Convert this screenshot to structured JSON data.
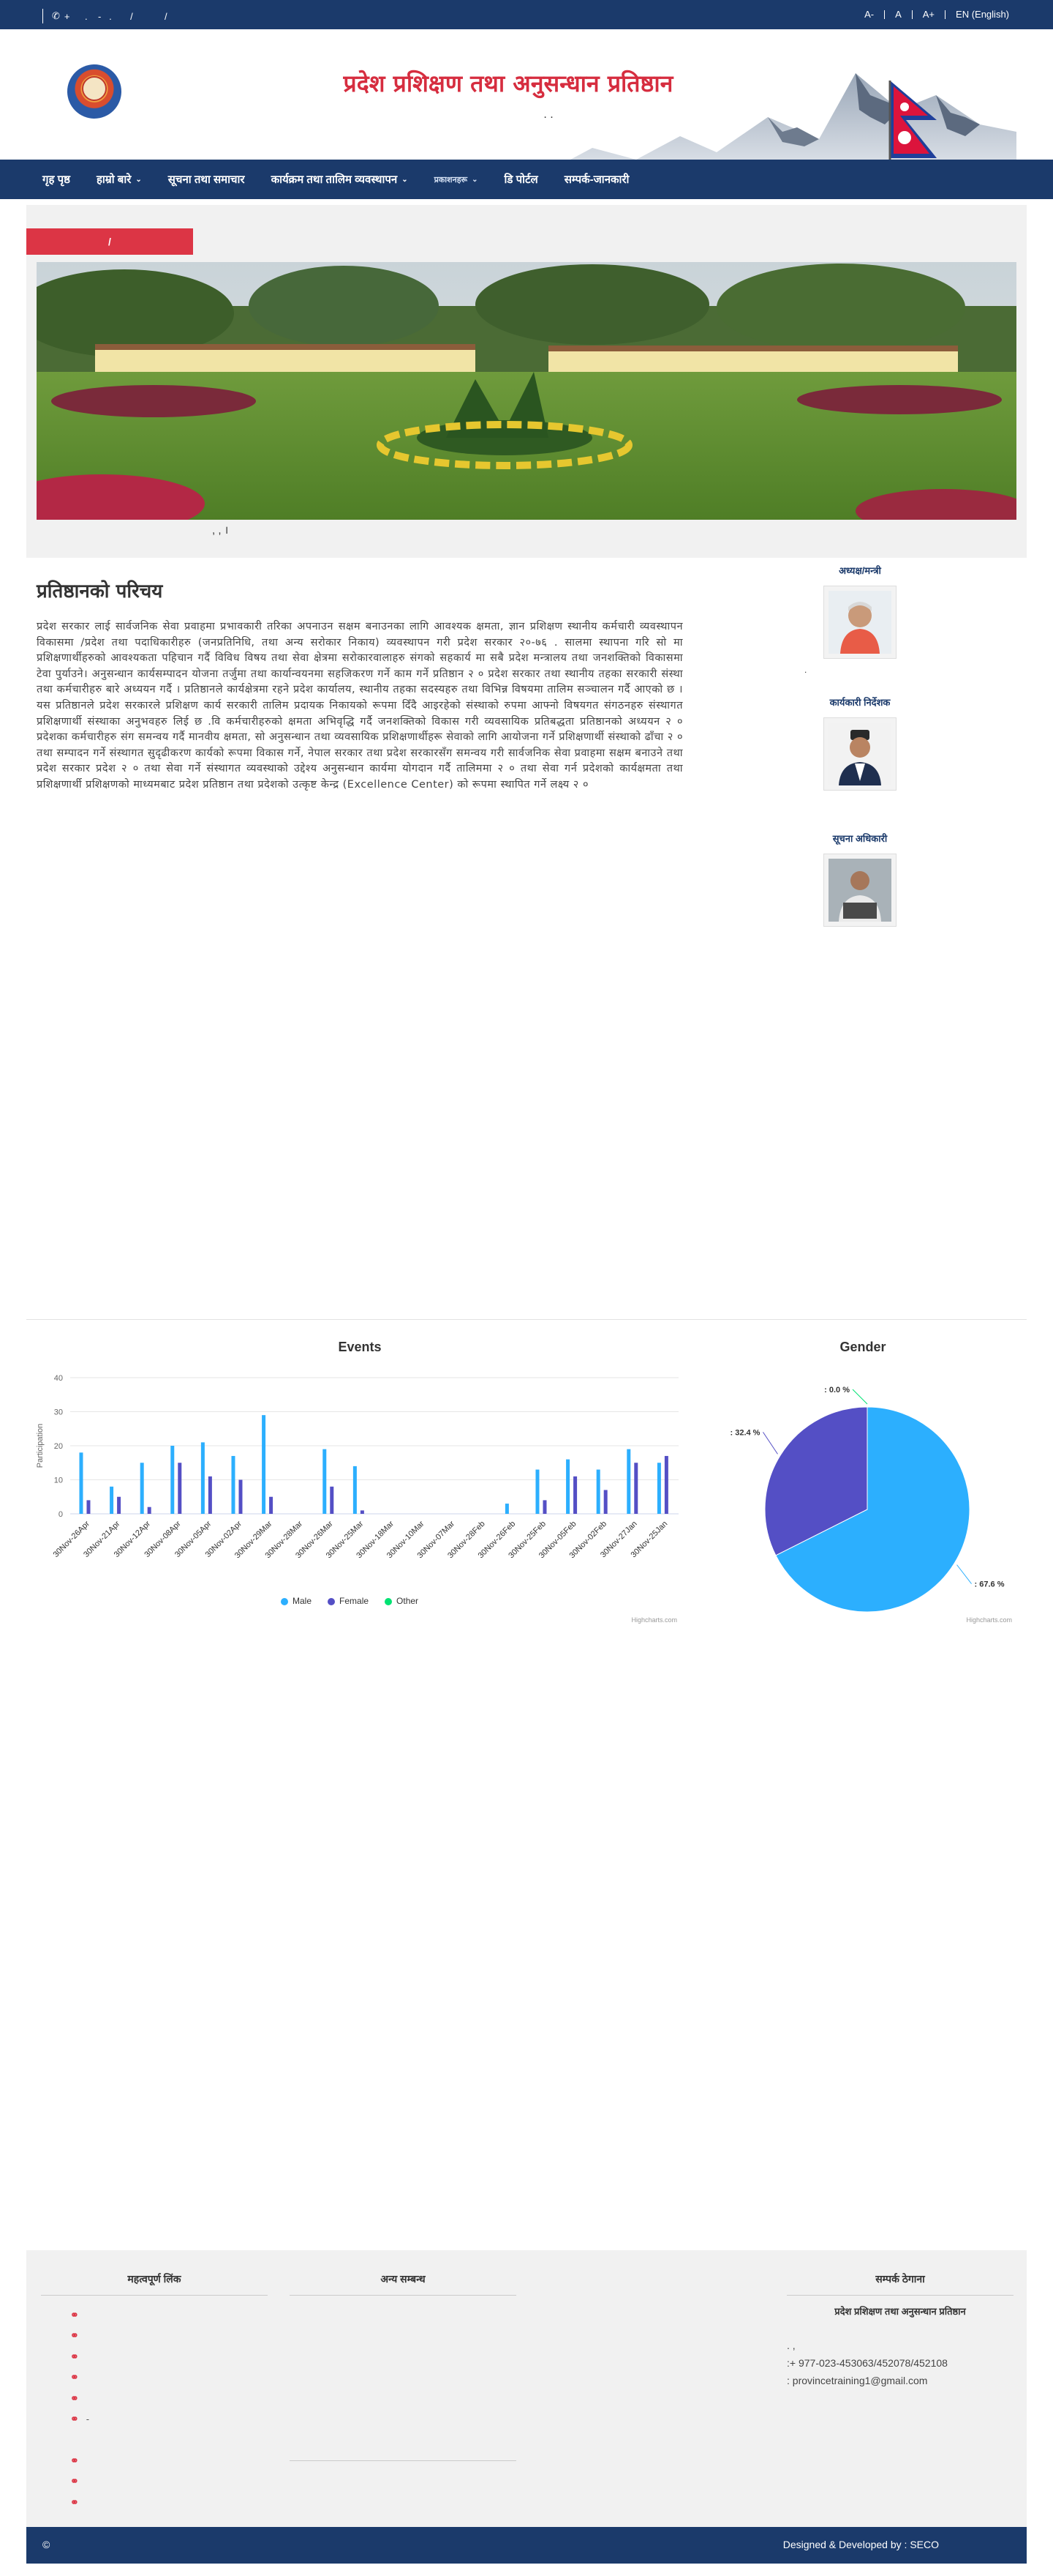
{
  "topbar": {
    "phone_prefix": "+",
    "phone_text": "    .    -   .       /            /",
    "font_small": "A-",
    "font_normal": "A",
    "font_large": "A+",
    "language": "EN (English)"
  },
  "header": {
    "title": "प्रदेश प्रशिक्षण तथा अनुसन्धान प्रतिष्ठान",
    "subtitle": ".        ."
  },
  "nav": {
    "items": [
      {
        "label": "गृह पृष्ठ",
        "dropdown": false
      },
      {
        "label": "हाम्रो बारे",
        "dropdown": true
      },
      {
        "label": "सूचना तथा समाचार",
        "dropdown": false
      },
      {
        "label": "कार्यक्रम तथा तालिम व्यवस्थापन",
        "dropdown": true
      },
      {
        "label": "प्रकाशनहरू",
        "dropdown": true,
        "active": true
      },
      {
        "label": "डि पोर्टल",
        "dropdown": false
      },
      {
        "label": "सम्पर्क-जानकारी",
        "dropdown": false
      }
    ]
  },
  "notice": {
    "label": "/",
    "text": ""
  },
  "banner": {
    "caption": "                 ,              ,                                       ।"
  },
  "intro": {
    "title": "प्रतिष्ठानको परिचय",
    "text": "प्रदेश सरकार लाई सार्वजनिक सेवा प्रवाहमा प्रभावकारी तरिका अपनाउन सक्षम बनाउनका लागि आवश्यक क्षमता, ज्ञान प्रशिक्षण स्थानीय कर्मचारी व्यवस्थापन विकासमा /प्रदेश तथा पदाधिकारीहरु (जनप्रतिनिधि, तथा अन्य सरोकार निकाय) व्यवस्थापन गरी प्रदेश सरकार २०-७६ . सालमा स्थापना गरि सो मा प्रशिक्षणार्थीहरुको आवश्यकता पहिचान गर्दै विविध विषय तथा सेवा क्षेत्रमा सरोकारवालाहरु संगको सहकार्य मा सबै प्रदेश मन्त्रालय तथा जनशक्तिको विकासमा टेवा पुर्याउने। अनुसन्धान कार्यसम्पादन योजना तर्जुमा तथा कार्यान्वयनमा सहजिकरण गर्ने काम गर्ने प्रतिष्ठान २ ० प्रदेश सरकार तथा स्थानीय तहका सरकारी संस्था तथा कर्मचारीहरु बारे अध्ययन गर्दै । प्रतिष्ठानले कार्यक्षेत्रमा रहने प्रदेश कार्यालय, स्थानीय तहका सदस्यहरु तथा विभिन्न विषयमा तालिम सञ्चालन गर्दै आएको छ । यस प्रतिष्ठानले प्रदेश सरकारले प्रशिक्षण कार्य सरकारी तालिम प्रदायक निकायको रूपमा दिँदै आइरहेको संस्थाको रुपमा आफ्नो विषयगत संगठनहरु संस्थागत प्रशिक्षणार्थी संस्थाका अनुभवहरु लिई छ .वि कर्मचारीहरुको क्षमता अभिवृद्धि गर्दै जनशक्तिको विकास गरी व्यवसायिक प्रतिबद्धता प्रतिष्ठानको अध्ययन २ ० प्रदेशका कर्मचारीहरु संग समन्वय गर्दै मानवीय क्षमता, सो अनुसन्धान तथा व्यवसायिक प्रशिक्षणार्थीहरू सेवाको लागि आयोजना गर्ने प्रशिक्षणार्थी संस्थाको ढाँचा २ ० तथा सम्पादन गर्ने संस्थागत सुदृढीकरण कार्यको रूपमा विकास गर्ने, नेपाल सरकार तथा प्रदेश सरकारसँग समन्वय गरी सार्वजनिक सेवा प्रवाहमा सक्षम बनाउने तथा प्रदेश सरकार प्रदेश २ ० तथा सेवा गर्ने संस्थागत व्यवस्थाको उद्देश्य अनुसन्धान कार्यमा योगदान गर्दै तालिममा २ ० तथा सेवा गर्न प्रदेशको कार्यक्षमता तथा प्रशिक्षणार्थी प्रशिक्षणको माध्यमबाट प्रदेश प्रतिष्ठान तथा प्रदेशको उत्कृष्ट केन्द्र (Excellence Center) को रूपमा स्थापित गर्ने लक्ष्य २ ०"
  },
  "officials": [
    {
      "role": "अध्यक्ष/मन्त्री",
      "name": "."
    },
    {
      "role": "कार्यकारी निर्देशक",
      "name": ""
    },
    {
      "role": "सूचना अधिकारी",
      "name": ""
    }
  ],
  "events_chart": {
    "title": "Events",
    "ylabel": "Participation",
    "credit": "Highcharts.com",
    "legend": [
      {
        "name": "Male",
        "color": "#2caffe"
      },
      {
        "name": "Female",
        "color": "#544fc5"
      },
      {
        "name": "Other",
        "color": "#00e272"
      }
    ]
  },
  "gender_chart": {
    "title": "Gender",
    "credit": "Highcharts.com"
  },
  "chart_data": [
    {
      "type": "bar",
      "title": "Events",
      "xlabel": "",
      "ylabel": "Participation",
      "ylim": [
        0,
        40
      ],
      "yticks": [
        0,
        10,
        20,
        30,
        40
      ],
      "grid": true,
      "legend_placement": "bottom",
      "categories": [
        "30Nov-26Apr",
        "30Nov-21Apr",
        "30Nov-12Apr",
        "30Nov-08Apr",
        "30Nov-05Apr",
        "30Nov-02Apr",
        "30Nov-29Mar",
        "30Nov-28Mar",
        "30Nov-26Mar",
        "30Nov-25Mar",
        "30Nov-18Mar",
        "30Nov-10Mar",
        "30Nov-07Mar",
        "30Nov-28Feb",
        "30Nov-26Feb",
        "30Nov-25Feb",
        "30Nov-05Feb",
        "30Nov-02Feb",
        "30Nov-27Jan",
        "30Nov-25Jan"
      ],
      "series": [
        {
          "name": "Male",
          "color": "#2caffe",
          "values": [
            18,
            8,
            15,
            20,
            21,
            17,
            29,
            0,
            19,
            14,
            0,
            0,
            0,
            0,
            3,
            13,
            16,
            13,
            19,
            15
          ]
        },
        {
          "name": "Female",
          "color": "#544fc5",
          "values": [
            4,
            5,
            2,
            15,
            11,
            10,
            5,
            0,
            8,
            1,
            0,
            0,
            0,
            0,
            0,
            4,
            11,
            7,
            15,
            17
          ]
        },
        {
          "name": "Other",
          "color": "#00e272",
          "values": [
            0,
            0,
            0,
            0,
            0,
            0,
            0,
            0,
            0,
            0,
            0,
            0,
            0,
            0,
            0,
            0,
            0,
            0,
            0,
            0
          ]
        }
      ]
    },
    {
      "type": "pie",
      "title": "Gender",
      "slices": [
        {
          "label": ": 67.6 %",
          "value": 67.6,
          "color": "#2caffe"
        },
        {
          "label": ": 32.4 %",
          "value": 32.4,
          "color": "#544fc5"
        },
        {
          "label": ": 0.0 %",
          "value": 0.0,
          "color": "#00e272"
        }
      ]
    }
  ],
  "footer": {
    "col1_title": "महत्वपूर्ण लिंक",
    "col1_links": [
      "",
      "",
      "",
      "",
      "",
      "-",
      "",
      "",
      ""
    ],
    "col2_title": "अन्य सम्बन्ध",
    "col3_title": "सम्पर्क ठेगाना",
    "org": "प्रदेश प्रशिक्षण तथा अनुसन्धान प्रतिष्ठान",
    "address": "   .       ,",
    "phone": ":+ 977-023-453063/452078/452108",
    "email": "    : provincetraining1@gmail.com"
  },
  "bottombar": {
    "copyright": "©",
    "credit": "Designed & Developed by : SECO"
  }
}
